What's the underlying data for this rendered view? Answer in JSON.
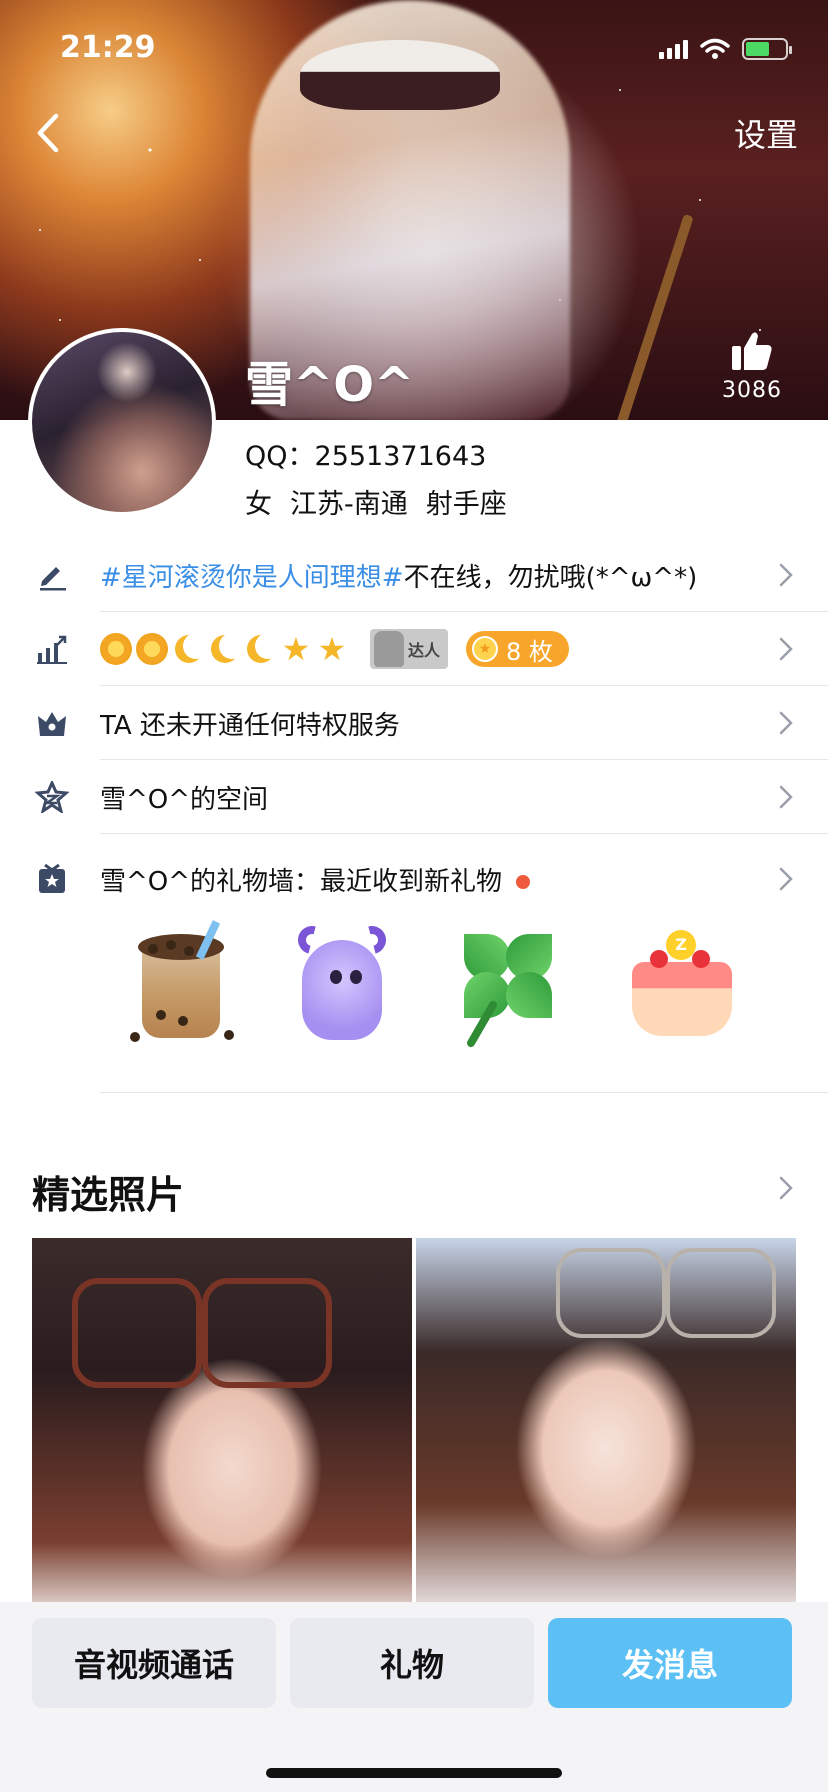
{
  "status_bar": {
    "time": "21:29"
  },
  "header": {
    "settings_label": "设置",
    "nickname": "雪^O^",
    "like_count": "3086"
  },
  "profile": {
    "qq_label": "QQ：",
    "qq_number": "2551371643",
    "gender": "女",
    "location": "江苏-南通",
    "zodiac": "射手座"
  },
  "rows": {
    "signature_hashtag": "#星河滚烫你是人间理想#",
    "signature_text": "不在线，勿扰哦(*^ω^*)",
    "daren_label": "达人",
    "medal_count": "8 枚",
    "privilege_text": "TA 还未开通任何特权服务",
    "space_text": "雪^O^的空间",
    "gift_wall_text": "雪^O^的礼物墙：最近收到新礼物"
  },
  "photos": {
    "title": "精选照片"
  },
  "actions": {
    "call_label": "音视频通话",
    "gift_label": "礼物",
    "message_label": "发消息"
  },
  "colors": {
    "hashtag": "#3a8ee6",
    "accent_button": "#5cc0f5",
    "medal_pill": "#f7a62b",
    "new_dot": "#f05a3c"
  }
}
